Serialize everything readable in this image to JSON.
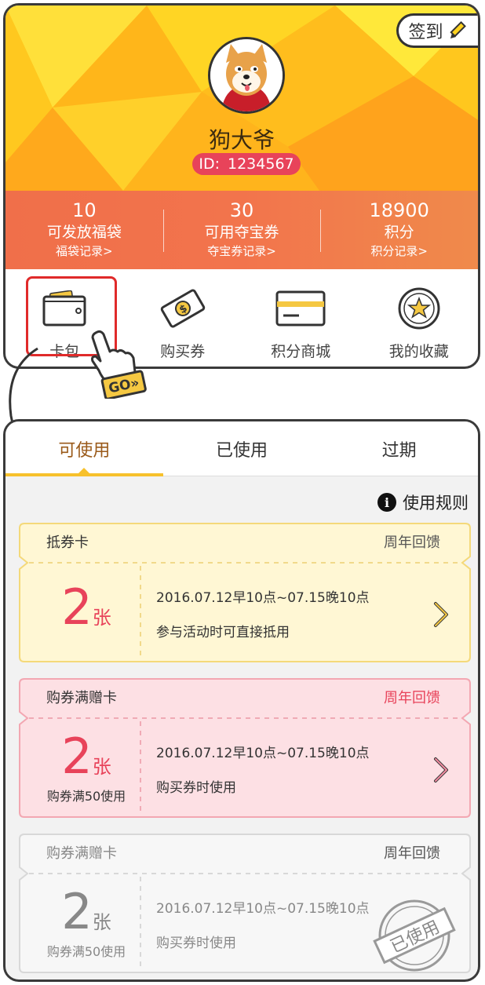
{
  "header": {
    "checkin_label": "签到",
    "nickname": "狗大爷",
    "id_label": "ID:",
    "id_value": "1234567"
  },
  "stats": [
    {
      "value": "10",
      "label": "可发放福袋",
      "link": "福袋记录>"
    },
    {
      "value": "30",
      "label": "可用夺宝券",
      "link": "夺宝券记录>"
    },
    {
      "value": "18900",
      "label": "积分",
      "link": "积分记录>"
    }
  ],
  "quick_menu": [
    {
      "label": "卡包",
      "icon": "wallet-icon"
    },
    {
      "label": "购买券",
      "icon": "coupon-ticket-icon"
    },
    {
      "label": "积分商城",
      "icon": "credit-card-icon"
    },
    {
      "label": "我的收藏",
      "icon": "star-icon"
    }
  ],
  "pointer": {
    "go_label": "GO»"
  },
  "tabs": [
    {
      "label": "可使用",
      "active": true
    },
    {
      "label": "已使用",
      "active": false
    },
    {
      "label": "过期",
      "active": false
    }
  ],
  "rules_label": "使用规则",
  "coupons": [
    {
      "name": "抵券卡",
      "tag": "周年回馈",
      "count": "2",
      "unit": "张",
      "condition": "",
      "time": "2016.07.12早10点~07.15晚10点",
      "desc": "参与活动时可直接抵用",
      "style": "yellow"
    },
    {
      "name": "购券满赠卡",
      "tag": "周年回馈",
      "count": "2",
      "unit": "张",
      "condition": "购券满50使用",
      "time": "2016.07.12早10点~07.15晚10点",
      "desc": "购买券时使用",
      "style": "pink"
    },
    {
      "name": "购券满赠卡",
      "tag": "周年回馈",
      "count": "2",
      "unit": "张",
      "condition": "购券满50使用",
      "time": "2016.07.12早10点~07.15晚10点",
      "desc": "购买券时使用",
      "style": "grey",
      "stamp": "已使用"
    }
  ],
  "colors": {
    "accent_yellow": "#f7c12c",
    "accent_red": "#e8435a",
    "stats_orange": "#f06f4a"
  }
}
